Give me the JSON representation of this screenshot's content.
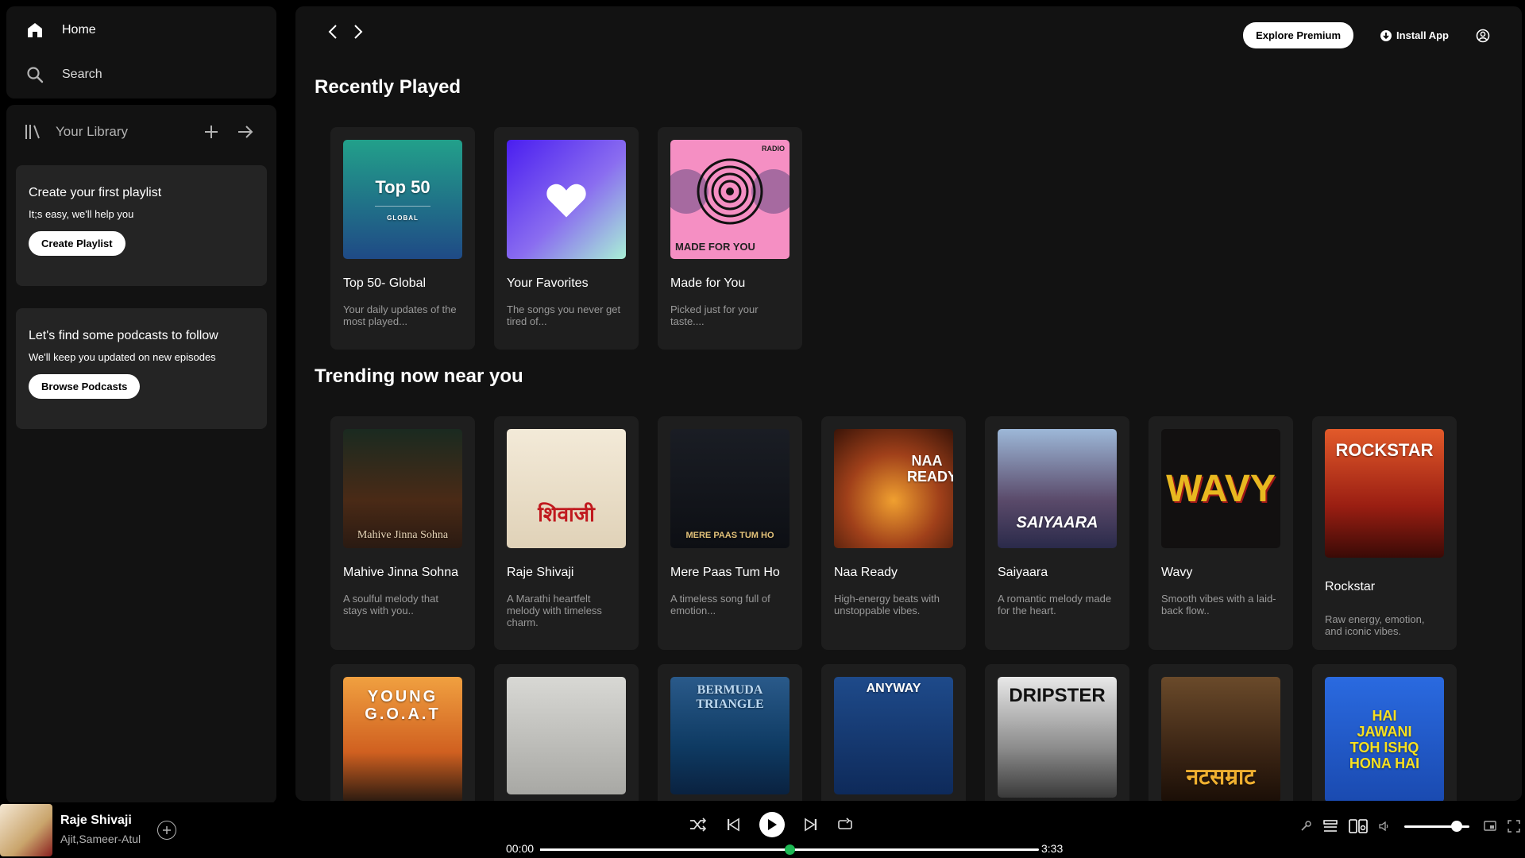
{
  "nav": {
    "home": "Home",
    "search": "Search"
  },
  "library": {
    "title": "Your Library",
    "playlist_promo": {
      "title": "Create your first playlist",
      "subtitle": "It;s easy, we'll help you",
      "button": "Create Playlist"
    },
    "podcast_promo": {
      "title": "Let's find some podcasts to follow",
      "subtitle": "We'll keep you updated on new episodes",
      "button": "Browse Podcasts"
    }
  },
  "topbar": {
    "explore": "Explore Premium",
    "install": "Install App"
  },
  "sections": {
    "recent": "Recently Played",
    "trending": "Trending now near you"
  },
  "recent": [
    {
      "title": "Top 50- Global",
      "desc": "Your daily updates of the most played...",
      "art_text": "Top 50",
      "art_sub": "GLOBAL"
    },
    {
      "title": "Your Favorites",
      "desc": "The songs you never get tired of..."
    },
    {
      "title": "Made for You",
      "desc": "Picked just for your taste....",
      "art_text": "MADE FOR YOU",
      "art_badge": "RADIO"
    }
  ],
  "trending": [
    {
      "title": "Mahive Jinna Sohna",
      "desc": "A soulful melody that stays with you..",
      "art_text": "Mahive Jinna Sohna"
    },
    {
      "title": "Raje Shivaji",
      "desc": "A Marathi heartfelt melody with timeless charm.",
      "art_text": "शिवाजी"
    },
    {
      "title": "Mere Paas Tum Ho",
      "desc": "A timeless song full of emotion...",
      "art_text": "MERE PAAS TUM HO"
    },
    {
      "title": "Naa Ready",
      "desc": "High-energy beats with unstoppable vibes.",
      "art_text": "NAA READY"
    },
    {
      "title": "Saiyaara",
      "desc": "A romantic melody made for the heart.",
      "art_text": "SAIYAARA"
    },
    {
      "title": "Wavy",
      "desc": "Smooth vibes with a laid-back flow..",
      "art_text": "WAVY"
    },
    {
      "title": "Rockstar",
      "desc": "Raw energy, emotion, and iconic vibes.",
      "art_text": "ROCKSTAR"
    }
  ],
  "third_row": [
    {
      "art_text": "YOUNG G.O.A.T"
    },
    {
      "art_text": ""
    },
    {
      "art_text": "BERMUDA TRIANGLE"
    },
    {
      "art_text": "ANYWAY"
    },
    {
      "art_text": "DRIPSTER"
    },
    {
      "art_text": "नटसम्राट"
    },
    {
      "art_text": "HAI JAWANI TOH ISHQ HONA HAI"
    }
  ],
  "player": {
    "title": "Raje Shivaji",
    "artist": "Ajit,Sameer-Atul",
    "current_time": "00:00",
    "total_time": "3:33",
    "progress_fraction": 0.5,
    "volume_fraction": 0.8
  },
  "colors": {
    "accent": "#1db954",
    "card": "#1e1e1e",
    "panel": "#121212"
  }
}
